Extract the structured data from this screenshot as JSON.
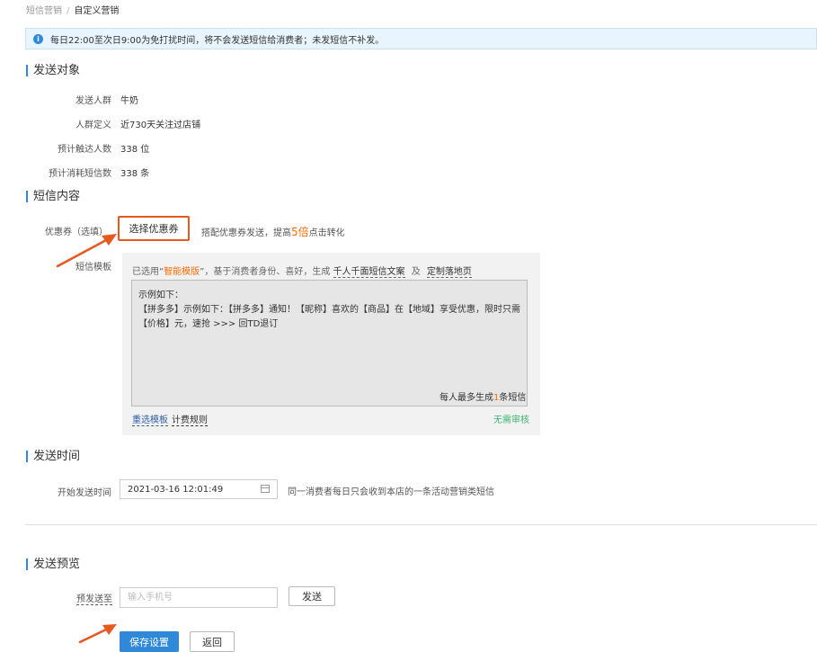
{
  "breadcrumb": {
    "parent": "短信营销",
    "separator": "/",
    "current": "自定义营销"
  },
  "notice": {
    "icon": "info-icon",
    "text": "每日22:00至次日9:00为免打扰时间，将不会发送短信给消费者；未发短信不补发。"
  },
  "send_target": {
    "title": "发送对象",
    "rows": [
      {
        "label": "发送人群",
        "value": "牛奶"
      },
      {
        "label": "人群定义",
        "value": "近730天关注过店铺"
      },
      {
        "label": "预计触达人数",
        "value": "338 位"
      },
      {
        "label": "预计消耗短信数",
        "value": "338 条"
      }
    ]
  },
  "sms_content": {
    "title": "短信内容",
    "coupon_label": "优惠券（选填）",
    "coupon_button": "选择优惠券",
    "coupon_hint_prefix": "搭配优惠券发送，提高",
    "coupon_hint_accent": "5倍",
    "coupon_hint_suffix": "点击转化",
    "template_label": "短信模板",
    "template_line": {
      "p1": "已选用“",
      "accent": "智能模版",
      "p2": "”，基于消费者身份、喜好，生成",
      "link1": "千人千面短信文案",
      "p3": "及",
      "link2": "定制落地页"
    },
    "template_text_lines": [
      "示例如下：",
      "【拼多多】示例如下：【拼多多】通知！【昵称】喜欢的【商品】在【地域】享受优惠，限时只需",
      "【价格】元，速抢 >>> 回TD退订"
    ],
    "template_count_prefix": "每人最多生成",
    "template_count_accent": "1",
    "template_count_suffix": "条短信",
    "reselect_link": "重选模板",
    "billing_link": "计费规则",
    "no_review": "无需审核"
  },
  "send_time": {
    "title": "发送时间",
    "start_label": "开始发送时间",
    "start_value": "2021-03-16 12:01:49",
    "note": "同一消费者每日只会收到本店的一条活动营销类短信"
  },
  "preview": {
    "title": "发送预览",
    "phone_label": "预发送至",
    "phone_placeholder": "输入手机号",
    "send_button": "发送"
  },
  "actions": {
    "save": "保存设置",
    "back": "返回"
  },
  "colors": {
    "accent_blue": "#2f88d8",
    "highlight_orange": "#e8571e",
    "success_green": "#3cb371"
  }
}
